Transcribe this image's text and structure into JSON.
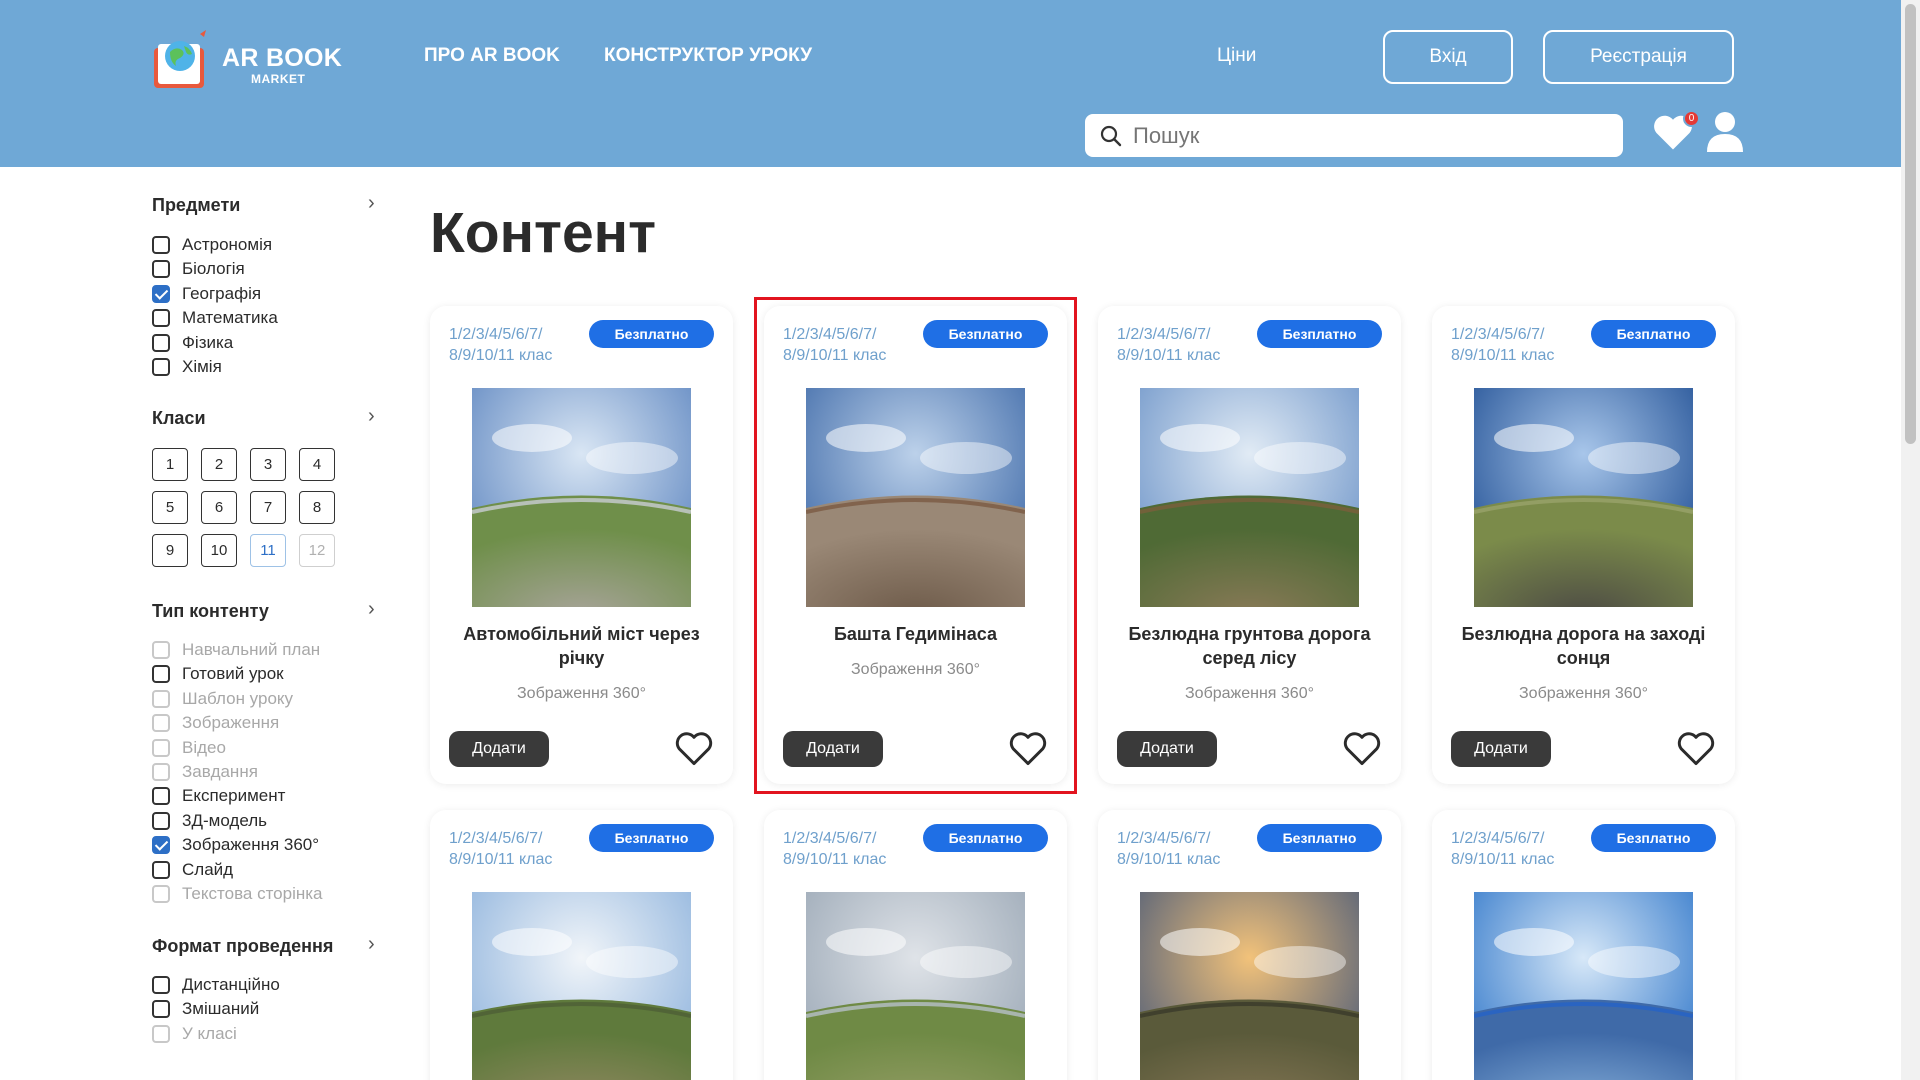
{
  "header": {
    "logo_text": "AR BOOK",
    "logo_sub": "MARKET",
    "nav": [
      "ПРО AR BOOK",
      "КОНСТРУКТОР УРОКУ"
    ],
    "prices": "Ціни",
    "login": "Вхід",
    "register": "Реєстрація",
    "search_placeholder": "Пошук",
    "favorites_count": "0"
  },
  "sidebar": {
    "subjects": {
      "title": "Предмети",
      "items": [
        {
          "label": "Астрономія",
          "checked": false
        },
        {
          "label": "Біологія",
          "checked": false
        },
        {
          "label": "Географія",
          "checked": true
        },
        {
          "label": "Математика",
          "checked": false
        },
        {
          "label": "Фізика",
          "checked": false
        },
        {
          "label": "Хімія",
          "checked": false
        }
      ]
    },
    "grades": {
      "title": "Класи",
      "items": [
        "1",
        "2",
        "3",
        "4",
        "5",
        "6",
        "7",
        "8",
        "9",
        "10",
        "11",
        "12"
      ],
      "active": "11",
      "disabled": [
        "12"
      ]
    },
    "content_type": {
      "title": "Тип контенту",
      "items": [
        {
          "label": "Навчальний план",
          "checked": false,
          "disabled": true
        },
        {
          "label": "Готовий урок",
          "checked": false,
          "disabled": false
        },
        {
          "label": "Шаблон уроку",
          "checked": false,
          "disabled": true
        },
        {
          "label": "Зображення",
          "checked": false,
          "disabled": true
        },
        {
          "label": "Відео",
          "checked": false,
          "disabled": true
        },
        {
          "label": "Завдання",
          "checked": false,
          "disabled": true
        },
        {
          "label": "Експеримент",
          "checked": false,
          "disabled": false
        },
        {
          "label": "3Д-модель",
          "checked": false,
          "disabled": false
        },
        {
          "label": "Зображення 360°",
          "checked": true,
          "disabled": false
        },
        {
          "label": "Слайд",
          "checked": false,
          "disabled": false
        },
        {
          "label": "Текстова сторінка",
          "checked": false,
          "disabled": true
        }
      ]
    },
    "format": {
      "title": "Формат проведення",
      "items": [
        {
          "label": "Дистанційно",
          "checked": false,
          "disabled": false
        },
        {
          "label": "Змішаний",
          "checked": false,
          "disabled": false
        },
        {
          "label": "У класі",
          "checked": false,
          "disabled": true
        }
      ]
    }
  },
  "main": {
    "title": "Контент",
    "card_grade": "1/2/3/4/5/6/7/\n8/9/10/11 клас",
    "card_grade_l1": "1/2/3/4/5/6/7/",
    "card_grade_l2": "8/9/10/11 клас",
    "badge": "Безплатно",
    "add_label": "Додати",
    "cards": [
      {
        "title": "Автомобільний міст через річку",
        "type": "Зображення 360°"
      },
      {
        "title": "Башта Гедимінаса",
        "type": "Зображення 360°"
      },
      {
        "title": "Безлюдна грунтова дорога серед лісу",
        "type": "Зображення 360°"
      },
      {
        "title": "Безлюдна дорога на заході сонця",
        "type": "Зображення 360°"
      },
      {
        "title": "",
        "type": ""
      },
      {
        "title": "",
        "type": ""
      },
      {
        "title": "",
        "type": ""
      },
      {
        "title": "",
        "type": ""
      }
    ]
  },
  "colors": {
    "header": "#6fa8d6",
    "badge": "#1f6fe5",
    "highlight": "#e2141f",
    "grade_text": "#6fa0cc"
  }
}
